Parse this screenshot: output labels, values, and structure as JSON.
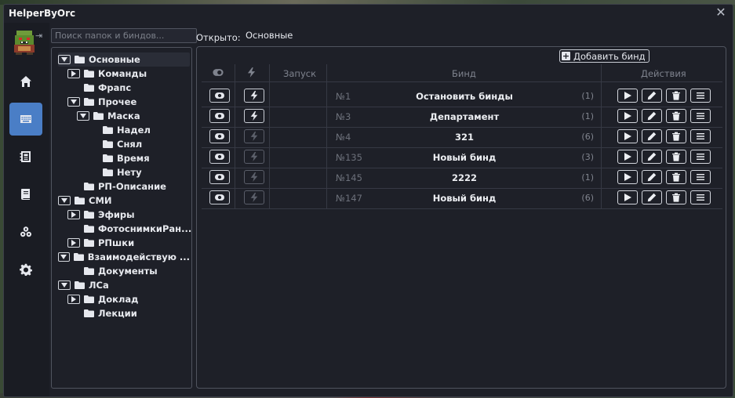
{
  "window": {
    "title": "HelperByOrc",
    "close_glyph": "✕"
  },
  "sidebar": {
    "items": [
      {
        "name": "home",
        "active": false
      },
      {
        "name": "binds",
        "active": true
      },
      {
        "name": "notes",
        "active": false
      },
      {
        "name": "documents",
        "active": false
      },
      {
        "name": "modules",
        "active": false
      },
      {
        "name": "settings",
        "active": false
      }
    ]
  },
  "search": {
    "placeholder": "Поиск папок и биндов...",
    "value": ""
  },
  "tree": {
    "nodes": [
      {
        "label": "Основные",
        "level": 0,
        "toggle": "down",
        "selected": true
      },
      {
        "label": "Команды",
        "level": 1,
        "toggle": "right"
      },
      {
        "label": "Фрапс",
        "level": 1,
        "toggle": null
      },
      {
        "label": "Прочее",
        "level": 1,
        "toggle": "down"
      },
      {
        "label": "Маска",
        "level": 2,
        "toggle": "down"
      },
      {
        "label": "Надел",
        "level": 3,
        "toggle": null
      },
      {
        "label": "Снял",
        "level": 3,
        "toggle": null
      },
      {
        "label": "Время",
        "level": 3,
        "toggle": null
      },
      {
        "label": "Нету",
        "level": 3,
        "toggle": null
      },
      {
        "label": "РП-Описание",
        "level": 1,
        "toggle": null
      },
      {
        "label": "СМИ",
        "level": 0,
        "toggle": "down"
      },
      {
        "label": "Эфиры",
        "level": 1,
        "toggle": "right"
      },
      {
        "label": "ФотоснимкиРан...",
        "level": 1,
        "toggle": null
      },
      {
        "label": "РПшки",
        "level": 1,
        "toggle": "right"
      },
      {
        "label": "Взаимодействую ...",
        "level": 0,
        "toggle": "down"
      },
      {
        "label": "Документы",
        "level": 1,
        "toggle": null
      },
      {
        "label": "ЛСа",
        "level": 0,
        "toggle": "down"
      },
      {
        "label": "Доклад",
        "level": 1,
        "toggle": "right"
      },
      {
        "label": "Лекции",
        "level": 1,
        "toggle": null
      }
    ]
  },
  "opened": {
    "label": "Открыто:",
    "value": "Основные"
  },
  "toolbar": {
    "add_label": "Добавить бинд",
    "add_glyph": "+"
  },
  "table": {
    "headers": {
      "launch": "Запуск",
      "bind": "Бинд",
      "actions": "Действия"
    },
    "rows": [
      {
        "id": "№1",
        "name": "Остановить бинды",
        "count": "(1)",
        "quick": true
      },
      {
        "id": "№3",
        "name": "Департамент",
        "count": "(1)",
        "quick": true
      },
      {
        "id": "№4",
        "name": "321",
        "count": "(6)",
        "quick": false
      },
      {
        "id": "№135",
        "name": "Новый бинд",
        "count": "(3)",
        "quick": false
      },
      {
        "id": "№145",
        "name": "2222",
        "count": "(1)",
        "quick": false
      },
      {
        "id": "№147",
        "name": "Новый бинд",
        "count": "(6)",
        "quick": false
      }
    ]
  },
  "colors": {
    "accent": "#4a7ec6",
    "background": "#1e2028",
    "border": "#50545f"
  }
}
